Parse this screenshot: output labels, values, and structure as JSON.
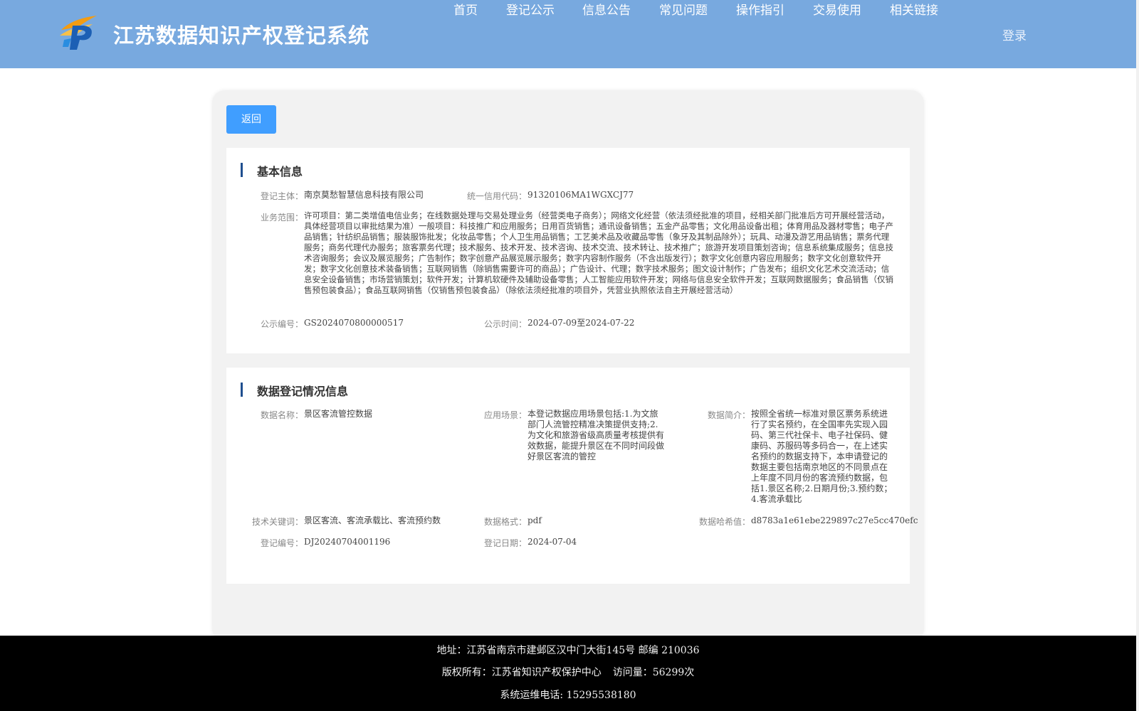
{
  "header": {
    "title": "江苏数据知识产权登记系统",
    "nav": [
      "首页",
      "登记公示",
      "信息公告",
      "常见问题",
      "操作指引",
      "交易使用",
      "相关链接"
    ],
    "login": "登录"
  },
  "back_label": "返回",
  "basic_info": {
    "title": "基本信息",
    "subject_label": "登记主体：",
    "subject_value": "南京莫愁智慧信息科技有限公司",
    "credit_label": "统一信用代码：",
    "credit_value": "91320106MA1WGXCJ77",
    "scope_label": "业务范围：",
    "scope_value": "许可项目：第二类增值电信业务；在线数据处理与交易处理业务（经营类电子商务）；网络文化经营（依法须经批准的项目，经相关部门批准后方可开展经营活动，具体经营项目以审批结果为准）一般项目：科技推广和应用服务；日用百货销售；通讯设备销售；五金产品零售；文化用品设备出租；体育用品及器材零售；电子产品销售；针纺织品销售；服装服饰批发；化妆品零售；个人卫生用品销售；工艺美术品及收藏品零售（象牙及其制品除外）；玩具、动漫及游艺用品销售；票务代理服务；商务代理代办服务；旅客票务代理；技术服务、技术开发、技术咨询、技术交流、技术转让、技术推广；旅游开发项目策划咨询；信息系统集成服务；信息技术咨询服务；会议及展览服务；广告制作；数字创意产品展览展示服务；数字内容制作服务（不含出版发行）；数字文化创意内容应用服务；数字文化创意软件开发；数字文化创意技术装备销售；互联网销售（除销售需要许可的商品）；广告设计、代理；数字技术服务；图文设计制作；广告发布；组织文化艺术交流活动；信息安全设备销售；市场营销策划；软件开发；计算机软硬件及辅助设备零售；人工智能应用软件开发；网络与信息安全软件开发；互联网数据服务；食品销售（仅销售预包装食品）；食品互联网销售（仅销售预包装食品）（除依法须经批准的项目外，凭营业执照依法自主开展经营活动）",
    "pub_no_label": "公示编号：",
    "pub_no_value": "GS2024070800000517",
    "pub_time_label": "公示时间：",
    "pub_time_value": "2024-07-09至2024-07-22"
  },
  "data_info": {
    "title": "数据登记情况信息",
    "name_label": "数据名称：",
    "name_value": "景区客流管控数据",
    "scene_label": "应用场景：",
    "scene_value": "本登记数据应用场景包括:1.为文旅部门人流管控精准决策提供支持;2.为文化和旅游省级高质量考核提供有效数据，能提升景区在不同时间段做好景区客流的管控",
    "intro_label": "数据简介：",
    "intro_value": "按照全省统一标准对景区票务系统进行了实名预约，在全国率先实现入园码、第三代社保卡、电子社保码、健康码、苏服码等多码合一，在上述实名预约的数据支持下，本申请登记的数据主要包括南京地区的不同景点在上年度不同月份的客流预约数据，包括1.景区名称;2.日期月份;3.预约数；4.客流承载比",
    "keyword_label": "技术关键词：",
    "keyword_value": "景区客流、客流承载比、客流预约数",
    "format_label": "数据格式：",
    "format_value": "pdf",
    "hash_label": "数据哈希值：",
    "hash_value": "d8783a1e61ebe229897c27e5cc470efc",
    "reg_no_label": "登记编号：",
    "reg_no_value": "DJ20240704001196",
    "reg_date_label": "登记日期：",
    "reg_date_value": "2024-07-04"
  },
  "footer": {
    "address": "地址：江苏省南京市建邺区汉中门大街145号 邮编 210036",
    "copyright": "版权所有：江苏省知识产权保护中心",
    "visits": "访问量：56299次",
    "phone": "系统运维电话: 15295538180"
  }
}
